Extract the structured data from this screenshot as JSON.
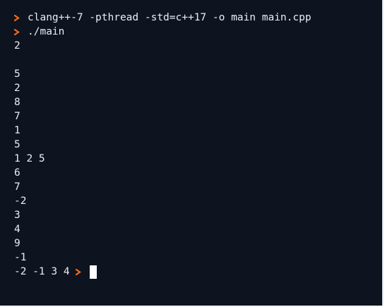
{
  "terminal": {
    "prompt_color": "#f26b1d",
    "background": "#0e1320",
    "text_color": "#e9edf4",
    "commands": [
      "clang++-7 -pthread -std=c++17 -o main main.cpp",
      "./main"
    ],
    "output": [
      "2",
      "",
      "5",
      "2",
      "8",
      "7",
      "1",
      "5",
      "1 2 5",
      "6",
      "7",
      "-2",
      "3",
      "4",
      "9",
      "-1"
    ],
    "last_line_text": "-2 -1 3 4"
  }
}
